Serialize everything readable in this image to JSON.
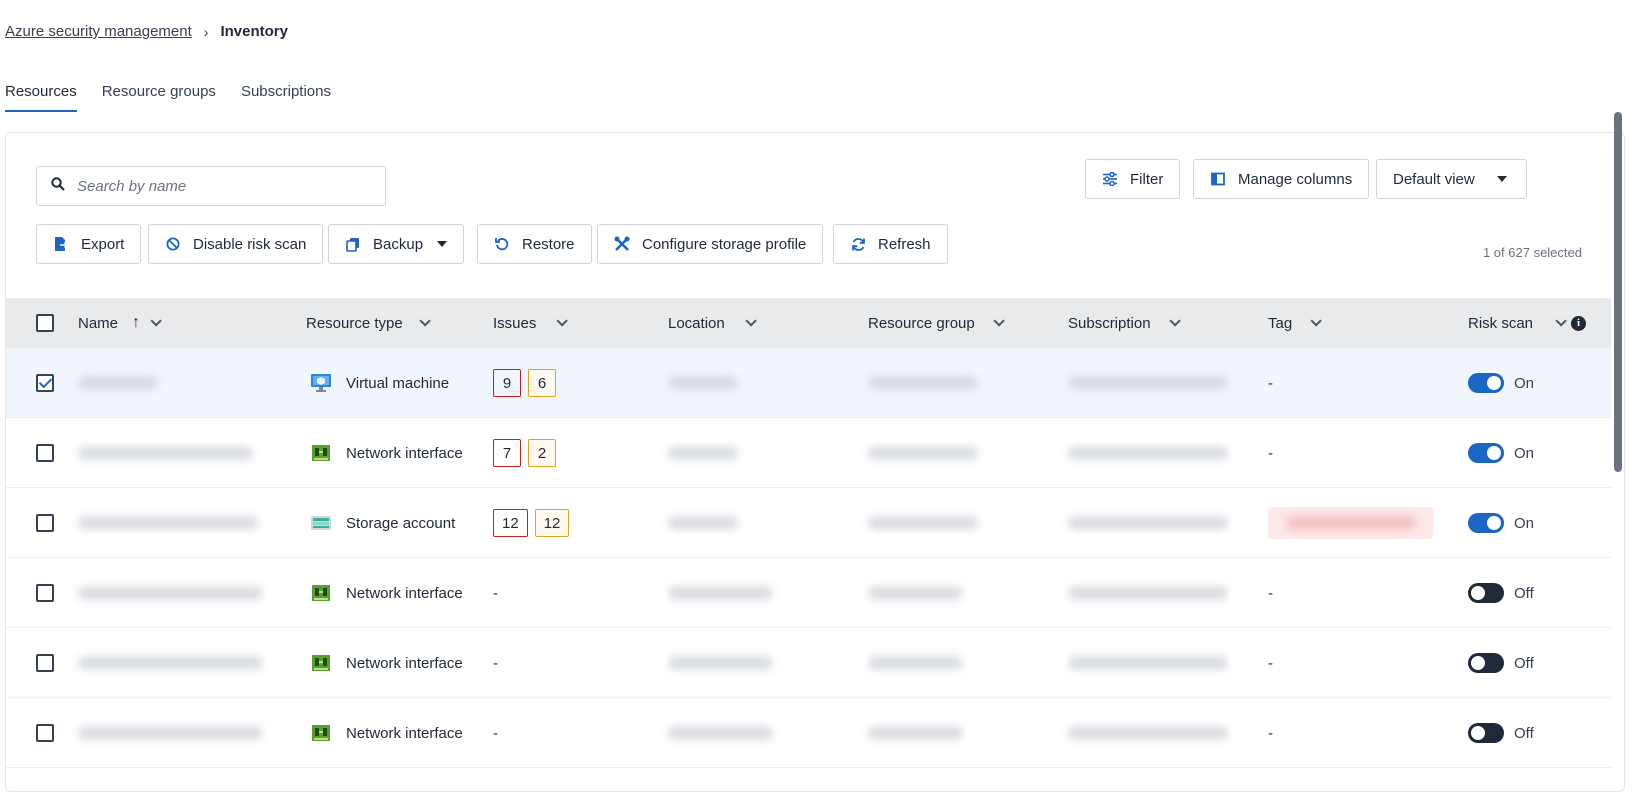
{
  "breadcrumb": {
    "parent": "Azure security management",
    "separator": "›",
    "current": "Inventory"
  },
  "tabs": [
    {
      "label": "Resources",
      "active": true
    },
    {
      "label": "Resource groups",
      "active": false
    },
    {
      "label": "Subscriptions",
      "active": false
    }
  ],
  "search": {
    "placeholder": "Search by name",
    "value": ""
  },
  "top_buttons": {
    "filter": "Filter",
    "manage_columns": "Manage columns",
    "view": "Default view"
  },
  "toolbar": {
    "export": "Export",
    "disable_risk_scan": "Disable risk scan",
    "backup": "Backup",
    "restore": "Restore",
    "configure_storage_profile": "Configure storage profile",
    "refresh": "Refresh"
  },
  "selection_text": "1 of 627 selected",
  "columns": {
    "name": "Name",
    "resource_type": "Resource type",
    "issues": "Issues",
    "location": "Location",
    "resource_group": "Resource group",
    "subscription": "Subscription",
    "tag": "Tag",
    "risk_scan": "Risk scan"
  },
  "rows": [
    {
      "checked": true,
      "resource_type": "Virtual machine",
      "type_icon": "virtual-machine-icon",
      "issues": [
        "9",
        "6"
      ],
      "tag": "-",
      "risk_scan": "On",
      "risk_on": true
    },
    {
      "checked": false,
      "resource_type": "Network interface",
      "type_icon": "network-interface-icon",
      "issues": [
        "7",
        "2"
      ],
      "tag": "-",
      "risk_scan": "On",
      "risk_on": true
    },
    {
      "checked": false,
      "resource_type": "Storage account",
      "type_icon": "storage-account-icon",
      "issues": [
        "12",
        "12"
      ],
      "tag": "",
      "risk_scan": "On",
      "risk_on": true
    },
    {
      "checked": false,
      "resource_type": "Network interface",
      "type_icon": "network-interface-icon",
      "issues_text": "-",
      "tag": "-",
      "risk_scan": "Off",
      "risk_on": false
    },
    {
      "checked": false,
      "resource_type": "Network interface",
      "type_icon": "network-interface-icon",
      "issues_text": "-",
      "tag": "-",
      "risk_scan": "Off",
      "risk_on": false
    },
    {
      "checked": false,
      "resource_type": "Network interface",
      "type_icon": "network-interface-icon",
      "issues_text": "-",
      "tag": "-",
      "risk_scan": "Off",
      "risk_on": false
    }
  ],
  "colors": {
    "accent": "#1a66c2",
    "issue_critical": "#c81e1e",
    "issue_high": "#e6a01e"
  }
}
